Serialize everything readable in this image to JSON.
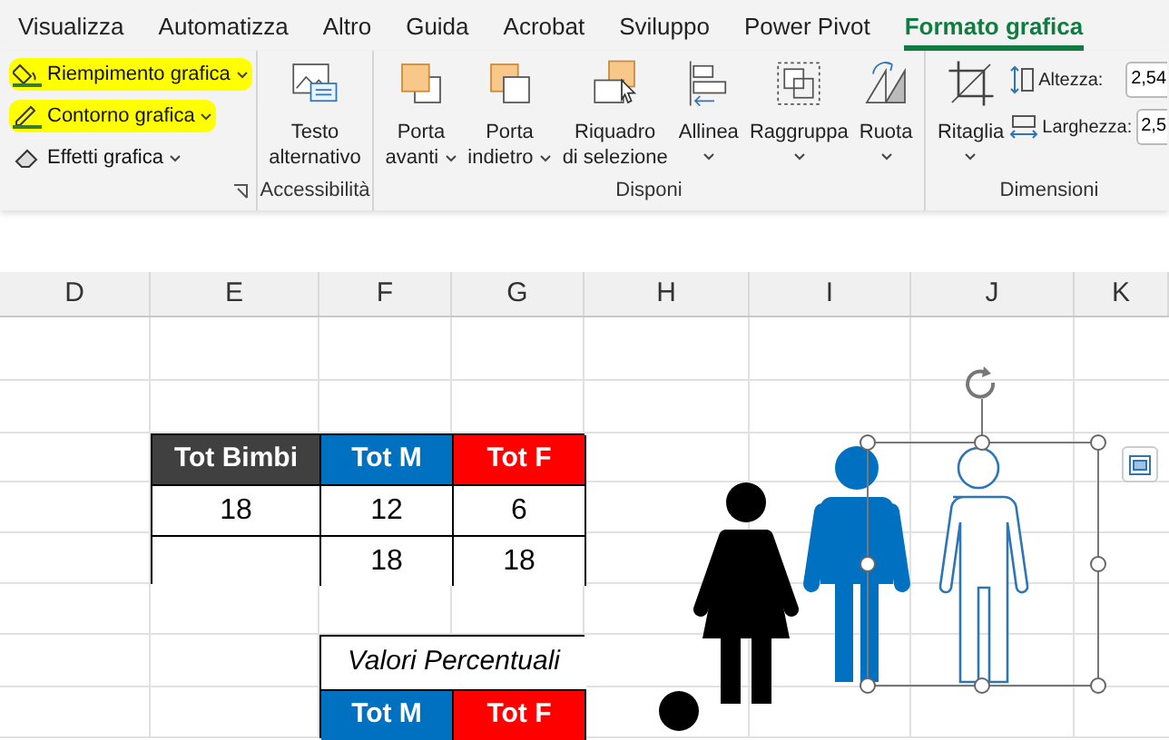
{
  "menu_tabs": [
    {
      "label": "Visualizza",
      "selected": false
    },
    {
      "label": "Automatizza",
      "selected": false
    },
    {
      "label": "Altro",
      "selected": false
    },
    {
      "label": "Guida",
      "selected": false
    },
    {
      "label": "Acrobat",
      "selected": false
    },
    {
      "label": "Sviluppo",
      "selected": false
    },
    {
      "label": "Power Pivot",
      "selected": false
    },
    {
      "label": "Formato grafica",
      "selected": true
    }
  ],
  "style_buttons": [
    {
      "kind": "fill",
      "label": "Riempimento grafica",
      "highlighted": true
    },
    {
      "kind": "outline",
      "label": "Contorno grafica",
      "highlighted": true
    },
    {
      "kind": "effects",
      "label": "Effetti grafica",
      "highlighted": false
    }
  ],
  "groups": [
    {
      "label": "Accessibilità",
      "buttons": [
        {
          "kind": "alt-text",
          "lines": [
            "Testo",
            "alternativo"
          ],
          "dropdown": false
        }
      ]
    },
    {
      "label": "Disponi",
      "buttons": [
        {
          "kind": "bring-forward",
          "lines": [
            "Porta",
            "avanti"
          ],
          "dropdown": true
        },
        {
          "kind": "send-backward",
          "lines": [
            "Porta",
            "indietro"
          ],
          "dropdown": true
        },
        {
          "kind": "selection-pane",
          "lines": [
            "Riquadro",
            "di selezione"
          ],
          "dropdown": false
        },
        {
          "kind": "align",
          "lines": [
            "Allinea"
          ],
          "dropdown": true
        },
        {
          "kind": "group",
          "lines": [
            "Raggruppa"
          ],
          "dropdown": true
        },
        {
          "kind": "rotate",
          "lines": [
            "Ruota"
          ],
          "dropdown": true
        }
      ]
    },
    {
      "label": "Dimensioni",
      "buttons": [
        {
          "kind": "crop",
          "lines": [
            "Ritaglia"
          ],
          "dropdown": true
        }
      ],
      "fields": [
        {
          "kind": "height",
          "label": "Altezza:",
          "value": "2,54"
        },
        {
          "kind": "width",
          "label": "Larghezza:",
          "value": "2,5"
        }
      ]
    }
  ],
  "columns": [
    "D",
    "E",
    "F",
    "G",
    "H",
    "I",
    "J",
    "K"
  ],
  "totals_table": {
    "headers": [
      {
        "text": "Tot Bimbi",
        "color": "#404040"
      },
      {
        "text": "Tot M",
        "color": "#0070c0"
      },
      {
        "text": "Tot F",
        "color": "#ff0000"
      }
    ],
    "rows": [
      [
        "18",
        "12",
        "6"
      ],
      [
        null,
        "18",
        "18"
      ]
    ]
  },
  "percent_table": {
    "title": "Valori Percentuali",
    "headers": [
      {
        "text": "Tot M",
        "color": "#0070c0"
      },
      {
        "text": "Tot F",
        "color": "#ff0000"
      }
    ]
  }
}
